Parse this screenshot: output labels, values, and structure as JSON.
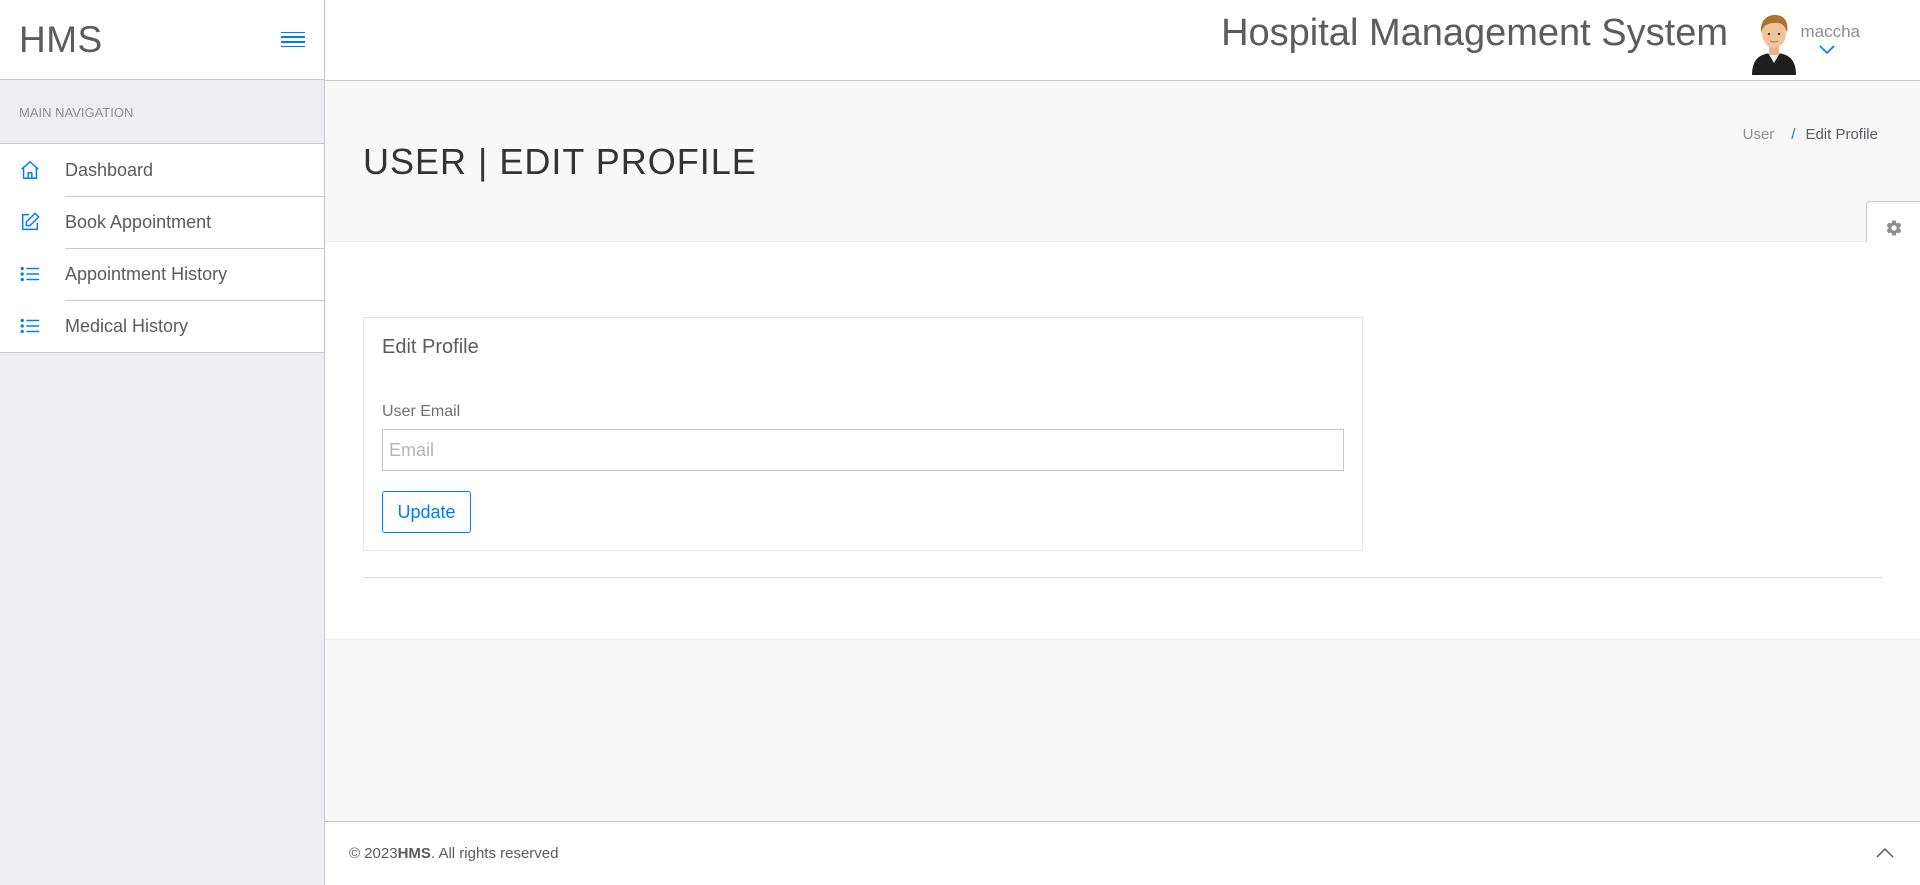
{
  "brand": {
    "name": "HMS"
  },
  "sidebar": {
    "nav_title": "MAIN NAVIGATION",
    "items": [
      {
        "label": "Dashboard",
        "icon": "home-icon"
      },
      {
        "label": "Book Appointment",
        "icon": "edit-icon"
      },
      {
        "label": "Appointment History",
        "icon": "list-icon"
      },
      {
        "label": "Medical History",
        "icon": "list-icon"
      }
    ]
  },
  "header": {
    "system_title": "Hospital Management System",
    "username": "maccha"
  },
  "page": {
    "title": "USER | EDIT PROFILE",
    "breadcrumb": {
      "parent": "User",
      "separator": "/",
      "current": "Edit Profile"
    }
  },
  "form": {
    "panel_title": "Edit Profile",
    "email_label": "User Email",
    "email_value": "",
    "email_placeholder": "Email",
    "submit_label": "Update"
  },
  "footer": {
    "prefix": "© 2023 ",
    "brand": "HMS",
    "suffix": ". All rights reserved"
  },
  "colors": {
    "accent": "#007aff",
    "text": "#5b5b60",
    "border": "#c8c7cc",
    "sidebar_bg": "#eeeef2"
  }
}
